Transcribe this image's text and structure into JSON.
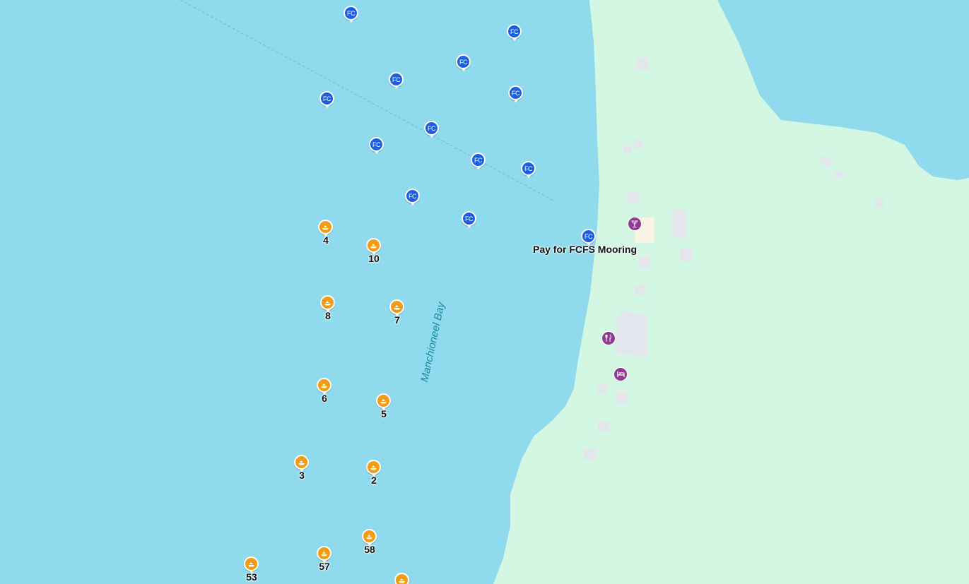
{
  "map": {
    "water_color": "#8fdaec",
    "land_color": "#d3f7e3",
    "building_color": "#e4e6ee",
    "fc_color": "#1a5fe0",
    "mooring_color": "#f29b16",
    "poi_color": "#8e3b8e",
    "bay_name": "Manchioneel Bay",
    "place_label": "Pay for FCFS Mooring",
    "fc_marker_text": "FC",
    "mooring_numbers": [
      "4",
      "10",
      "8",
      "7",
      "6",
      "5",
      "3",
      "2",
      "58",
      "57",
      "53"
    ],
    "poi_icons": [
      "cocktail-bar-icon",
      "restaurant-icon",
      "hotel-icon"
    ]
  }
}
